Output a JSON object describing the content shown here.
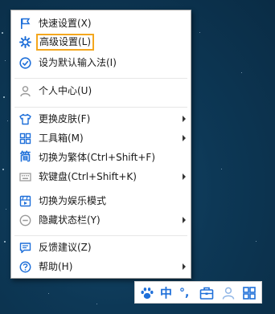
{
  "menu": {
    "items": [
      {
        "label": "快速设置(X)",
        "icon": "flag-icon"
      },
      {
        "label": "高级设置(L)",
        "icon": "gear-icon"
      },
      {
        "label": "设为默认输入法(I)",
        "icon": "check-circle-icon"
      },
      {
        "label": "个人中心(U)",
        "icon": "user-icon"
      },
      {
        "label": "更换皮肤(F)",
        "icon": "shirt-icon"
      },
      {
        "label": "工具箱(M)",
        "icon": "grid-icon"
      },
      {
        "label": "切换为繁体(Ctrl+Shift+F)",
        "icon": "traditional-char-icon",
        "glyph": "简"
      },
      {
        "label": "软键盘(Ctrl+Shift+K)",
        "icon": "keyboard-icon"
      },
      {
        "label": "切换为娱乐模式",
        "icon": "entertainment-icon"
      },
      {
        "label": "隐藏状态栏(Y)",
        "icon": "minus-circle-icon"
      },
      {
        "label": "反馈建议(Z)",
        "icon": "feedback-icon"
      },
      {
        "label": "帮助(H)",
        "icon": "question-circle-icon"
      }
    ]
  },
  "tray": {
    "lang": "中",
    "punct": "°,",
    "icons": [
      "paw-icon",
      "chinese-mode-icon",
      "punctuation-icon",
      "toolbox-icon",
      "user-icon",
      "grid-icon"
    ]
  },
  "colors": {
    "accent": "#1e6fd9",
    "highlight": "#f4a71e"
  }
}
